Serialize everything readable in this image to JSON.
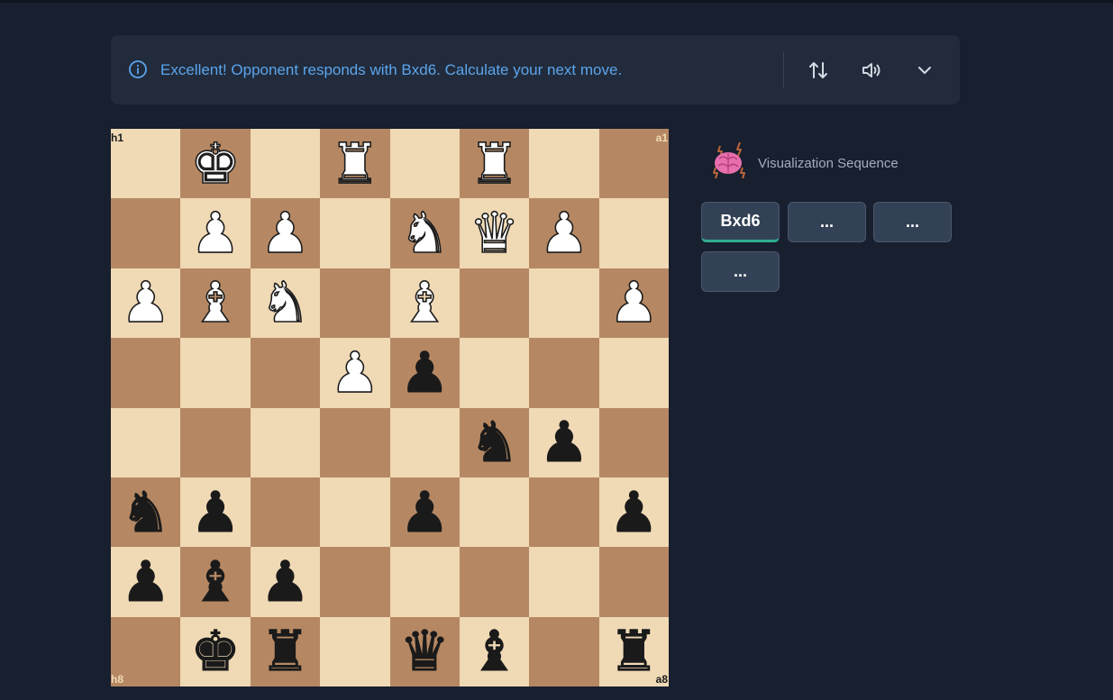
{
  "banner": {
    "message": "Excellent! Opponent responds with Bxd6. Calculate your next move.",
    "icons": [
      "info-circle-icon",
      "swap-vertical-icon",
      "speaker-icon",
      "chevron-down-icon"
    ],
    "accent_color": "#5aa5ee"
  },
  "board": {
    "orientation": "black-bottom",
    "corner_labels": {
      "top_left": "h1",
      "top_right": "a1",
      "bottom_left": "h8",
      "bottom_right": "a8"
    },
    "light_square_color": "#f0d9b5",
    "dark_square_color": "#b58863",
    "pieces": [
      {
        "sq": "g1",
        "piece": "K",
        "color": "w"
      },
      {
        "sq": "e1",
        "piece": "R",
        "color": "w"
      },
      {
        "sq": "c1",
        "piece": "R",
        "color": "w"
      },
      {
        "sq": "g2",
        "piece": "P",
        "color": "w"
      },
      {
        "sq": "f2",
        "piece": "P",
        "color": "w"
      },
      {
        "sq": "d2",
        "piece": "N",
        "color": "w"
      },
      {
        "sq": "c2",
        "piece": "Q",
        "color": "w"
      },
      {
        "sq": "b2",
        "piece": "P",
        "color": "w"
      },
      {
        "sq": "h3",
        "piece": "P",
        "color": "w"
      },
      {
        "sq": "g3",
        "piece": "B",
        "color": "w"
      },
      {
        "sq": "f3",
        "piece": "N",
        "color": "w"
      },
      {
        "sq": "d3",
        "piece": "B",
        "color": "w"
      },
      {
        "sq": "a3",
        "piece": "P",
        "color": "w"
      },
      {
        "sq": "e4",
        "piece": "P",
        "color": "w"
      },
      {
        "sq": "d4",
        "piece": "P",
        "color": "b"
      },
      {
        "sq": "c5",
        "piece": "N",
        "color": "b"
      },
      {
        "sq": "b5",
        "piece": "P",
        "color": "b"
      },
      {
        "sq": "h6",
        "piece": "N",
        "color": "b"
      },
      {
        "sq": "g6",
        "piece": "P",
        "color": "b"
      },
      {
        "sq": "d6",
        "piece": "P",
        "color": "b"
      },
      {
        "sq": "a6",
        "piece": "P",
        "color": "b"
      },
      {
        "sq": "h7",
        "piece": "P",
        "color": "b"
      },
      {
        "sq": "g7",
        "piece": "B",
        "color": "b"
      },
      {
        "sq": "f7",
        "piece": "P",
        "color": "b"
      },
      {
        "sq": "g8",
        "piece": "K",
        "color": "b"
      },
      {
        "sq": "f8",
        "piece": "R",
        "color": "b"
      },
      {
        "sq": "d8",
        "piece": "Q",
        "color": "b"
      },
      {
        "sq": "c8",
        "piece": "B",
        "color": "b"
      },
      {
        "sq": "a8",
        "piece": "R",
        "color": "b"
      }
    ]
  },
  "sequence": {
    "icon": "brain-icon",
    "title": "Visualization Sequence",
    "moves": [
      {
        "label": "Bxd6",
        "active": true
      },
      {
        "label": "...",
        "active": false
      },
      {
        "label": "...",
        "active": false
      },
      {
        "label": "...",
        "active": false
      }
    ],
    "active_underline_color": "#2fae8f"
  }
}
